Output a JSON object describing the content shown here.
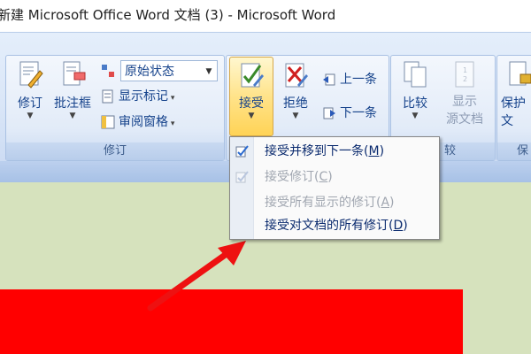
{
  "window": {
    "title": "新建 Microsoft Office Word 文档 (3) - Microsoft Word"
  },
  "ribbon": {
    "review_group": {
      "label": "修订",
      "track_changes": "修订",
      "comment_box": "批注框",
      "display_state": "原始状态",
      "show_markup": "显示标记",
      "review_pane": "审阅窗格"
    },
    "changes_group": {
      "accept": "接受",
      "reject": "拒绝",
      "previous": "上一条",
      "next": "下一条"
    },
    "compare_group": {
      "label": "较",
      "compare": "比较",
      "show_source_line1": "显示",
      "show_source_line2": "源文档"
    },
    "protect_group": {
      "label": "保",
      "protect": "保护文"
    }
  },
  "accept_menu": {
    "items": [
      {
        "text": "接受并移到下一条",
        "key": "M",
        "enabled": true,
        "icon": "accept-next-icon"
      },
      {
        "text": "接受修订",
        "key": "C",
        "enabled": false,
        "icon": "accept-change-icon"
      },
      {
        "text": "接受所有显示的修订",
        "key": "A",
        "enabled": false,
        "icon": ""
      },
      {
        "text": "接受对文档的所有修订",
        "key": "D",
        "enabled": true,
        "icon": ""
      }
    ]
  },
  "colors": {
    "ribbon_text": "#15428b",
    "document_bg": "#d6e2bd",
    "red_block": "#ff0000",
    "arrow": "#ee1111",
    "accept_highlight": "#ffe38a"
  }
}
